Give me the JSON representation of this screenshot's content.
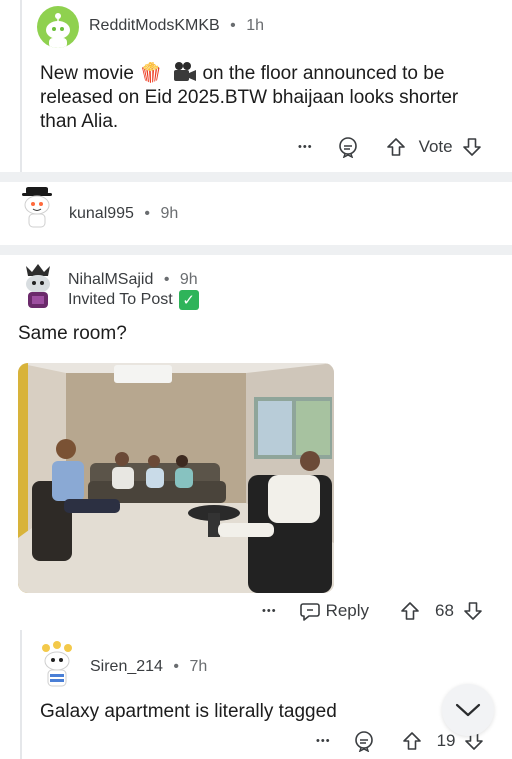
{
  "comment1": {
    "username": "RedditModsKMKB",
    "separator": "•",
    "time": "1h",
    "text_before": "New movie ",
    "text_emoji": "🍿",
    "text_after": " on the floor announced to be released on Eid 2025.BTW bhaijaan looks shorter than Alia.",
    "actions": {
      "more": "•••",
      "vote": "Vote"
    }
  },
  "comment2": {
    "username": "kunal995",
    "separator": "•",
    "time": "9h"
  },
  "comment3": {
    "username": "NihalMSajid",
    "separator": "•",
    "time": "9h",
    "flair": "Invited To Post",
    "flair_check": "✓",
    "text": "Same room?",
    "actions": {
      "more": "•••",
      "reply": "Reply",
      "score": "68"
    }
  },
  "comment4": {
    "username": "Siren_214",
    "separator": "•",
    "time": "7h",
    "text": "Galaxy apartment is literally tagged",
    "actions": {
      "more": "•••",
      "score": "19"
    }
  },
  "icons": {
    "upvote": "arrow-up-icon",
    "downvote": "arrow-down-icon",
    "award": "award-icon",
    "reply": "reply-bubble-icon",
    "scroll": "chevron-down-icon"
  },
  "colors": {
    "background": "#ffffff",
    "divider": "#eef0f2",
    "text": "#1c1c1c",
    "muted": "#6a6d70",
    "verified": "#2fb45a"
  }
}
